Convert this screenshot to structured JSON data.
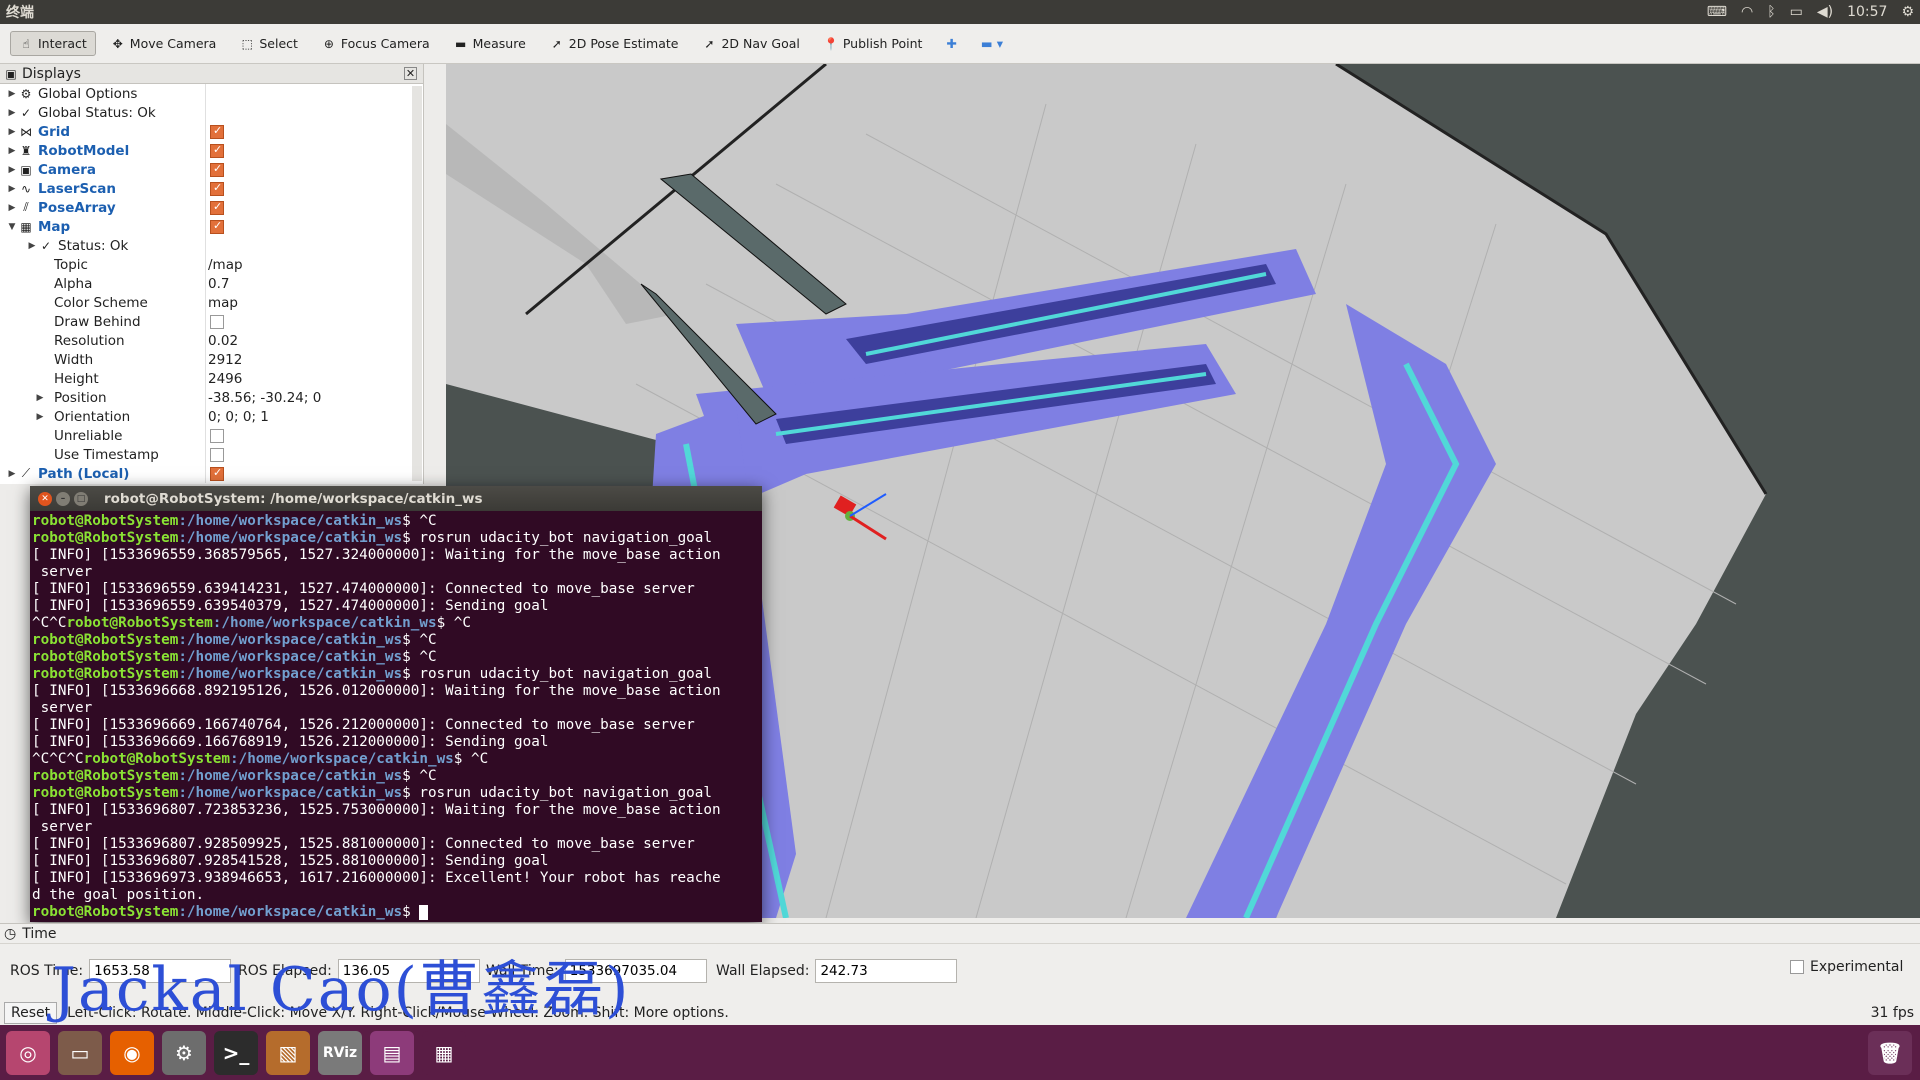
{
  "topbar": {
    "title": "终端",
    "time": "10:57"
  },
  "toolbar": {
    "tools": [
      {
        "label": "Interact",
        "icon": "cursor-icon",
        "glyph": "☝"
      },
      {
        "label": "Move Camera",
        "icon": "move-camera-icon",
        "glyph": "✥"
      },
      {
        "label": "Select",
        "icon": "select-icon",
        "glyph": "⬚"
      },
      {
        "label": "Focus Camera",
        "icon": "focus-camera-icon",
        "glyph": "⊕"
      },
      {
        "label": "Measure",
        "icon": "measure-icon",
        "glyph": "▬"
      },
      {
        "label": "2D Pose Estimate",
        "icon": "pose-estimate-icon",
        "glyph": "➚"
      },
      {
        "label": "2D Nav Goal",
        "icon": "nav-goal-icon",
        "glyph": "➚"
      },
      {
        "label": "Publish Point",
        "icon": "publish-point-icon",
        "glyph": "📍"
      }
    ]
  },
  "displays": {
    "title": "Displays",
    "rows": [
      {
        "label": "Global Options",
        "glyph": "⚙"
      },
      {
        "label": "Global Status: Ok",
        "glyph": "✓"
      },
      {
        "label": "Grid",
        "glyph": "⋈"
      },
      {
        "label": "RobotModel",
        "glyph": "♜"
      },
      {
        "label": "Camera",
        "glyph": "▣"
      },
      {
        "label": "LaserScan",
        "glyph": "∿"
      },
      {
        "label": "PoseArray",
        "glyph": "⫽"
      },
      {
        "label": "Map",
        "glyph": "▦"
      },
      {
        "label": "Status: Ok",
        "glyph": "✓"
      },
      {
        "label": "Topic",
        "value": "/map"
      },
      {
        "label": "Alpha",
        "value": "0.7"
      },
      {
        "label": "Color Scheme",
        "value": "map"
      },
      {
        "label": "Draw Behind"
      },
      {
        "label": "Resolution",
        "value": "0.02"
      },
      {
        "label": "Width",
        "value": "2912"
      },
      {
        "label": "Height",
        "value": "2496"
      },
      {
        "label": "Position",
        "value": "-38.56; -30.24; 0"
      },
      {
        "label": "Orientation",
        "value": "0; 0; 0; 1"
      },
      {
        "label": "Unreliable"
      },
      {
        "label": "Use Timestamp"
      },
      {
        "label": "Path (Local)",
        "glyph": "⟋"
      }
    ]
  },
  "terminal": {
    "title": "robot@RobotSystem: /home/workspace/catkin_ws",
    "prompt_user": "robot@RobotSystem",
    "prompt_path": ":/home/workspace/catkin_ws",
    "lines": [
      {
        "t": "prompt",
        "cmd": "$ ^C"
      },
      {
        "t": "prompt",
        "cmd": "$ rosrun udacity_bot navigation_goal"
      },
      {
        "t": "text",
        "text": "[ INFO] [1533696559.368579565, 1527.324000000]: Waiting for the move_base action"
      },
      {
        "t": "text",
        "text": " server"
      },
      {
        "t": "text",
        "text": "[ INFO] [1533696559.639414231, 1527.474000000]: Connected to move_base server"
      },
      {
        "t": "text",
        "text": "[ INFO] [1533696559.639540379, 1527.474000000]: Sending goal"
      },
      {
        "t": "prefixed",
        "pre": "^C^C",
        "cmd": "$ ^C"
      },
      {
        "t": "prompt",
        "cmd": "$ ^C"
      },
      {
        "t": "prompt",
        "cmd": "$ ^C"
      },
      {
        "t": "prompt",
        "cmd": "$ rosrun udacity_bot navigation_goal"
      },
      {
        "t": "text",
        "text": "[ INFO] [1533696668.892195126, 1526.012000000]: Waiting for the move_base action"
      },
      {
        "t": "text",
        "text": " server"
      },
      {
        "t": "text",
        "text": "[ INFO] [1533696669.166740764, 1526.212000000]: Connected to move_base server"
      },
      {
        "t": "text",
        "text": "[ INFO] [1533696669.166768919, 1526.212000000]: Sending goal"
      },
      {
        "t": "prefixed",
        "pre": "^C^C^C",
        "cmd": "$ ^C"
      },
      {
        "t": "prompt",
        "cmd": "$ ^C"
      },
      {
        "t": "prompt",
        "cmd": "$ rosrun udacity_bot navigation_goal"
      },
      {
        "t": "text",
        "text": "[ INFO] [1533696807.723853236, 1525.753000000]: Waiting for the move_base action"
      },
      {
        "t": "text",
        "text": " server"
      },
      {
        "t": "text",
        "text": "[ INFO] [1533696807.928509925, 1525.881000000]: Connected to move_base server"
      },
      {
        "t": "text",
        "text": "[ INFO] [1533696807.928541528, 1525.881000000]: Sending goal"
      },
      {
        "t": "text",
        "text": "[ INFO] [1533696973.938946653, 1617.216000000]: Excellent! Your robot has reache"
      },
      {
        "t": "text",
        "text": "d the goal position."
      },
      {
        "t": "prompt",
        "cmd": "$ ",
        "cursor": true
      }
    ]
  },
  "time": {
    "title": "Time",
    "ros_time_label": "ROS Time:",
    "ros_time": "1653.58",
    "ros_elapsed_label": "ROS Elapsed:",
    "ros_elapsed": "136.05",
    "wall_time_label": "Wall Time:",
    "wall_time": "1533697035.04",
    "wall_elapsed_label": "Wall Elapsed:",
    "wall_elapsed": "242.73",
    "experimental_label": "Experimental"
  },
  "status": {
    "reset": "Reset",
    "hint": "Left-Click: Rotate. Middle-Click: Move X/Y. Right-Click/Mouse Wheel: Zoom. Shift: More options.",
    "fps": "31 fps"
  },
  "watermark": "Jackal Cao(曹鑫磊)",
  "launcher": [
    {
      "name": "ubuntu-logo-icon",
      "glyph": "◎",
      "color": "#b6466f"
    },
    {
      "name": "files-icon",
      "glyph": "▭",
      "color": "#7d5b4a"
    },
    {
      "name": "firefox-icon",
      "glyph": "◉",
      "color": "#e66000"
    },
    {
      "name": "settings-icon",
      "glyph": "⚙",
      "color": "#6d6d6d"
    },
    {
      "name": "terminal-icon",
      "glyph": ">_",
      "color": "#2c2c2c"
    },
    {
      "name": "package-icon",
      "glyph": "▧",
      "color": "#b56c2c"
    },
    {
      "name": "rviz-icon",
      "glyph": "RViz",
      "color": "#7a7a7a"
    },
    {
      "name": "window-icon",
      "glyph": "▤",
      "color": "#8d3b7a"
    },
    {
      "name": "workspace-icon",
      "glyph": "▦",
      "color": "#5a1d45"
    }
  ],
  "trash_icon": "trash-icon"
}
